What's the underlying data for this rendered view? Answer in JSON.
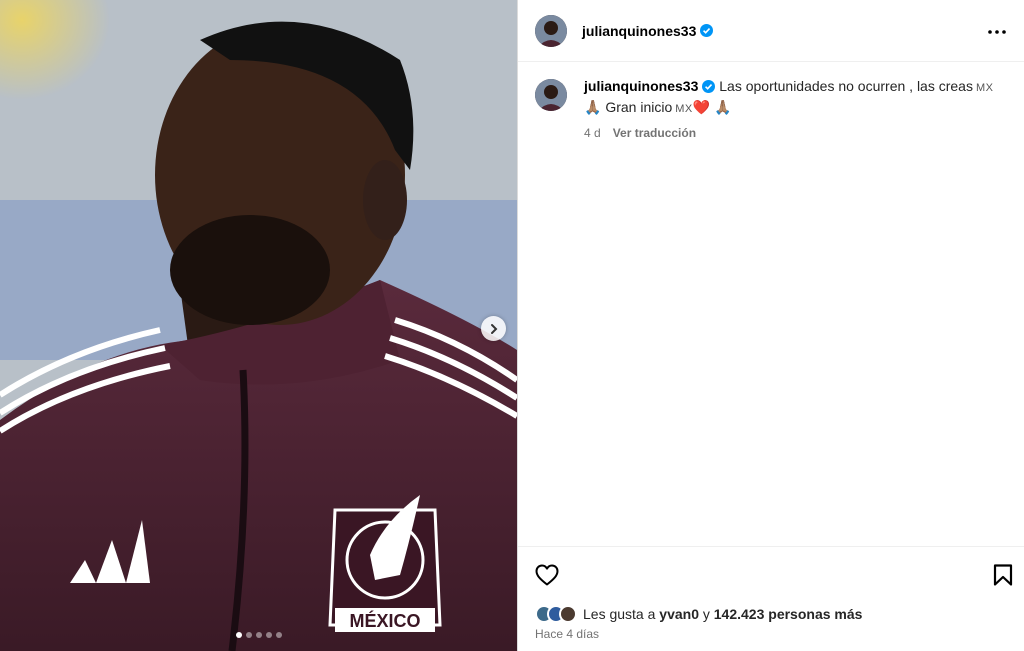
{
  "post": {
    "author": {
      "username": "julianquinones33",
      "verified": true,
      "avatar_icon": "profile-photo-avatar"
    },
    "media": {
      "carousel_dots": 5,
      "active_index": 0,
      "next_icon": "chevron-right-icon",
      "jersey_crest_text": "MÉXICO"
    },
    "caption": {
      "text_line1": "Las oportunidades no ocurren , las creas",
      "flag1": "MX",
      "pray1": "🙏🏽",
      "text_line2": "Gran inicio",
      "flag2": "MX",
      "heart": "❤️",
      "pray2": "🙏🏽"
    },
    "meta": {
      "age": "4 d",
      "translate_label": "Ver traducción"
    },
    "likes": {
      "prefix": "Les gusta a",
      "user": "yvan0",
      "connector": "y",
      "others": "142.423 personas más"
    },
    "time_ago": "Hace 4 días",
    "icons": {
      "more": "more-options-icon",
      "like": "heart-icon",
      "save": "bookmark-icon"
    },
    "colors": {
      "verified": "#0095f6",
      "heart": "#e0245e",
      "jersey": "#4a2430"
    }
  }
}
